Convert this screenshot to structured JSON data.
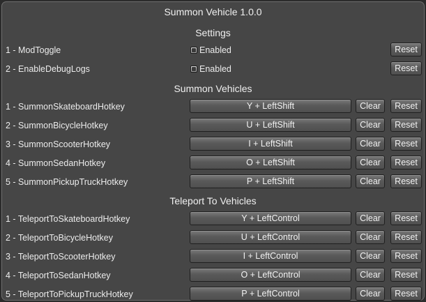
{
  "window": {
    "title": "Summon Vehicle 1.0.0"
  },
  "sections": {
    "settings": "Settings",
    "summon": "Summon Vehicles",
    "teleport": "Teleport To Vehicles"
  },
  "settings_rows": [
    {
      "label": "1 - ModToggle",
      "value": "Enabled",
      "checked": true,
      "reset": "Reset"
    },
    {
      "label": "2 - EnableDebugLogs",
      "value": "Enabled",
      "checked": true,
      "reset": "Reset"
    }
  ],
  "summon_rows": [
    {
      "label": "1 - SummonSkateboardHotkey",
      "hotkey": "Y + LeftShift",
      "clear": "Clear",
      "reset": "Reset"
    },
    {
      "label": "2 - SummonBicycleHotkey",
      "hotkey": "U + LeftShift",
      "clear": "Clear",
      "reset": "Reset"
    },
    {
      "label": "3 - SummonScooterHotkey",
      "hotkey": "I + LeftShift",
      "clear": "Clear",
      "reset": "Reset"
    },
    {
      "label": "4 - SummonSedanHotkey",
      "hotkey": "O + LeftShift",
      "clear": "Clear",
      "reset": "Reset"
    },
    {
      "label": "5 - SummonPickupTruckHotkey",
      "hotkey": "P + LeftShift",
      "clear": "Clear",
      "reset": "Reset"
    }
  ],
  "teleport_rows": [
    {
      "label": "1 - TeleportToSkateboardHotkey",
      "hotkey": "Y + LeftControl",
      "clear": "Clear",
      "reset": "Reset"
    },
    {
      "label": "2 - TeleportToBicycleHotkey",
      "hotkey": "U + LeftControl",
      "clear": "Clear",
      "reset": "Reset"
    },
    {
      "label": "3 - TeleportToScooterHotkey",
      "hotkey": "I + LeftControl",
      "clear": "Clear",
      "reset": "Reset"
    },
    {
      "label": "4 - TeleportToSedanHotkey",
      "hotkey": "O + LeftControl",
      "clear": "Clear",
      "reset": "Reset"
    },
    {
      "label": "5 - TeleportToPickupTruckHotkey",
      "hotkey": "P + LeftControl",
      "clear": "Clear",
      "reset": "Reset"
    }
  ]
}
